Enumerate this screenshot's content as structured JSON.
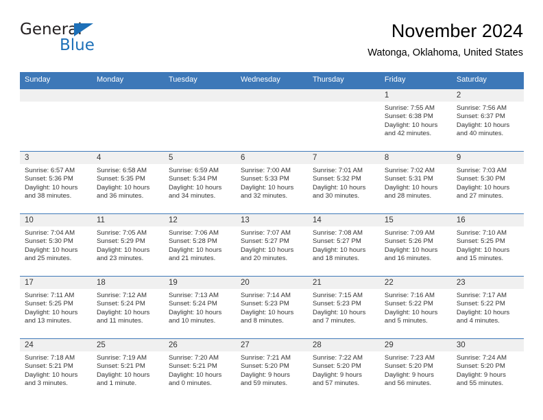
{
  "logo": {
    "word_top": "General",
    "word_bottom": "Blue",
    "triangle_color": "#1d70b8"
  },
  "header": {
    "title": "November 2024",
    "subtitle": "Watonga, Oklahoma, United States"
  },
  "theme": {
    "header_blue": "#3d78b8",
    "daynum_band": "#f0f0f0",
    "text": "#333333"
  },
  "calendar": {
    "weekday_headers": [
      "Sunday",
      "Monday",
      "Tuesday",
      "Wednesday",
      "Thursday",
      "Friday",
      "Saturday"
    ],
    "labels": {
      "sunrise": "Sunrise:",
      "sunset": "Sunset:",
      "daylight": "Daylight:"
    },
    "weeks": [
      [
        {
          "day": "",
          "empty": true
        },
        {
          "day": "",
          "empty": true
        },
        {
          "day": "",
          "empty": true
        },
        {
          "day": "",
          "empty": true
        },
        {
          "day": "",
          "empty": true
        },
        {
          "day": "1",
          "sunrise": "Sunrise: 7:55 AM",
          "sunset": "Sunset: 6:38 PM",
          "daylight_line1": "Daylight: 10 hours",
          "daylight_line2": "and 42 minutes."
        },
        {
          "day": "2",
          "sunrise": "Sunrise: 7:56 AM",
          "sunset": "Sunset: 6:37 PM",
          "daylight_line1": "Daylight: 10 hours",
          "daylight_line2": "and 40 minutes."
        }
      ],
      [
        {
          "day": "3",
          "sunrise": "Sunrise: 6:57 AM",
          "sunset": "Sunset: 5:36 PM",
          "daylight_line1": "Daylight: 10 hours",
          "daylight_line2": "and 38 minutes."
        },
        {
          "day": "4",
          "sunrise": "Sunrise: 6:58 AM",
          "sunset": "Sunset: 5:35 PM",
          "daylight_line1": "Daylight: 10 hours",
          "daylight_line2": "and 36 minutes."
        },
        {
          "day": "5",
          "sunrise": "Sunrise: 6:59 AM",
          "sunset": "Sunset: 5:34 PM",
          "daylight_line1": "Daylight: 10 hours",
          "daylight_line2": "and 34 minutes."
        },
        {
          "day": "6",
          "sunrise": "Sunrise: 7:00 AM",
          "sunset": "Sunset: 5:33 PM",
          "daylight_line1": "Daylight: 10 hours",
          "daylight_line2": "and 32 minutes."
        },
        {
          "day": "7",
          "sunrise": "Sunrise: 7:01 AM",
          "sunset": "Sunset: 5:32 PM",
          "daylight_line1": "Daylight: 10 hours",
          "daylight_line2": "and 30 minutes."
        },
        {
          "day": "8",
          "sunrise": "Sunrise: 7:02 AM",
          "sunset": "Sunset: 5:31 PM",
          "daylight_line1": "Daylight: 10 hours",
          "daylight_line2": "and 28 minutes."
        },
        {
          "day": "9",
          "sunrise": "Sunrise: 7:03 AM",
          "sunset": "Sunset: 5:30 PM",
          "daylight_line1": "Daylight: 10 hours",
          "daylight_line2": "and 27 minutes."
        }
      ],
      [
        {
          "day": "10",
          "sunrise": "Sunrise: 7:04 AM",
          "sunset": "Sunset: 5:30 PM",
          "daylight_line1": "Daylight: 10 hours",
          "daylight_line2": "and 25 minutes."
        },
        {
          "day": "11",
          "sunrise": "Sunrise: 7:05 AM",
          "sunset": "Sunset: 5:29 PM",
          "daylight_line1": "Daylight: 10 hours",
          "daylight_line2": "and 23 minutes."
        },
        {
          "day": "12",
          "sunrise": "Sunrise: 7:06 AM",
          "sunset": "Sunset: 5:28 PM",
          "daylight_line1": "Daylight: 10 hours",
          "daylight_line2": "and 21 minutes."
        },
        {
          "day": "13",
          "sunrise": "Sunrise: 7:07 AM",
          "sunset": "Sunset: 5:27 PM",
          "daylight_line1": "Daylight: 10 hours",
          "daylight_line2": "and 20 minutes."
        },
        {
          "day": "14",
          "sunrise": "Sunrise: 7:08 AM",
          "sunset": "Sunset: 5:27 PM",
          "daylight_line1": "Daylight: 10 hours",
          "daylight_line2": "and 18 minutes."
        },
        {
          "day": "15",
          "sunrise": "Sunrise: 7:09 AM",
          "sunset": "Sunset: 5:26 PM",
          "daylight_line1": "Daylight: 10 hours",
          "daylight_line2": "and 16 minutes."
        },
        {
          "day": "16",
          "sunrise": "Sunrise: 7:10 AM",
          "sunset": "Sunset: 5:25 PM",
          "daylight_line1": "Daylight: 10 hours",
          "daylight_line2": "and 15 minutes."
        }
      ],
      [
        {
          "day": "17",
          "sunrise": "Sunrise: 7:11 AM",
          "sunset": "Sunset: 5:25 PM",
          "daylight_line1": "Daylight: 10 hours",
          "daylight_line2": "and 13 minutes."
        },
        {
          "day": "18",
          "sunrise": "Sunrise: 7:12 AM",
          "sunset": "Sunset: 5:24 PM",
          "daylight_line1": "Daylight: 10 hours",
          "daylight_line2": "and 11 minutes."
        },
        {
          "day": "19",
          "sunrise": "Sunrise: 7:13 AM",
          "sunset": "Sunset: 5:24 PM",
          "daylight_line1": "Daylight: 10 hours",
          "daylight_line2": "and 10 minutes."
        },
        {
          "day": "20",
          "sunrise": "Sunrise: 7:14 AM",
          "sunset": "Sunset: 5:23 PM",
          "daylight_line1": "Daylight: 10 hours",
          "daylight_line2": "and 8 minutes."
        },
        {
          "day": "21",
          "sunrise": "Sunrise: 7:15 AM",
          "sunset": "Sunset: 5:23 PM",
          "daylight_line1": "Daylight: 10 hours",
          "daylight_line2": "and 7 minutes."
        },
        {
          "day": "22",
          "sunrise": "Sunrise: 7:16 AM",
          "sunset": "Sunset: 5:22 PM",
          "daylight_line1": "Daylight: 10 hours",
          "daylight_line2": "and 5 minutes."
        },
        {
          "day": "23",
          "sunrise": "Sunrise: 7:17 AM",
          "sunset": "Sunset: 5:22 PM",
          "daylight_line1": "Daylight: 10 hours",
          "daylight_line2": "and 4 minutes."
        }
      ],
      [
        {
          "day": "24",
          "sunrise": "Sunrise: 7:18 AM",
          "sunset": "Sunset: 5:21 PM",
          "daylight_line1": "Daylight: 10 hours",
          "daylight_line2": "and 3 minutes."
        },
        {
          "day": "25",
          "sunrise": "Sunrise: 7:19 AM",
          "sunset": "Sunset: 5:21 PM",
          "daylight_line1": "Daylight: 10 hours",
          "daylight_line2": "and 1 minute."
        },
        {
          "day": "26",
          "sunrise": "Sunrise: 7:20 AM",
          "sunset": "Sunset: 5:21 PM",
          "daylight_line1": "Daylight: 10 hours",
          "daylight_line2": "and 0 minutes."
        },
        {
          "day": "27",
          "sunrise": "Sunrise: 7:21 AM",
          "sunset": "Sunset: 5:20 PM",
          "daylight_line1": "Daylight: 9 hours",
          "daylight_line2": "and 59 minutes."
        },
        {
          "day": "28",
          "sunrise": "Sunrise: 7:22 AM",
          "sunset": "Sunset: 5:20 PM",
          "daylight_line1": "Daylight: 9 hours",
          "daylight_line2": "and 57 minutes."
        },
        {
          "day": "29",
          "sunrise": "Sunrise: 7:23 AM",
          "sunset": "Sunset: 5:20 PM",
          "daylight_line1": "Daylight: 9 hours",
          "daylight_line2": "and 56 minutes."
        },
        {
          "day": "30",
          "sunrise": "Sunrise: 7:24 AM",
          "sunset": "Sunset: 5:20 PM",
          "daylight_line1": "Daylight: 9 hours",
          "daylight_line2": "and 55 minutes."
        }
      ]
    ]
  }
}
